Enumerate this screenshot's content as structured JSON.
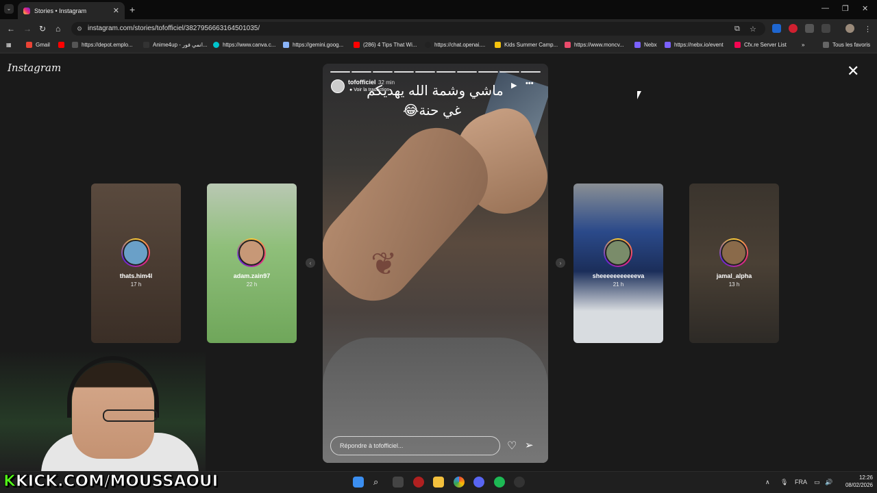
{
  "browser": {
    "tab_title": "Stories • Instagram",
    "new_tab_symbol": "+",
    "close_tab_symbol": "✕",
    "url": "instagram.com/stories/tofofficiel/3827956663164501035/",
    "bookmarks": [
      {
        "label": "Gmail",
        "color": "#ea4335"
      },
      {
        "label": "",
        "color": "#ff0000"
      },
      {
        "label": "https://depot.emplo...",
        "color": "#555555"
      },
      {
        "label": "Anime4up - انمي فور...",
        "color": "#333333"
      },
      {
        "label": "https://www.canva.c...",
        "color": "#00c4cc"
      },
      {
        "label": "https://gemini.goog...",
        "color": "#8ab4f8"
      },
      {
        "label": "(286) 4 Tips That Wi...",
        "color": "#ff0000"
      },
      {
        "label": "https://chat.openai....",
        "color": "#222222"
      },
      {
        "label": "Kids Summer Camp...",
        "color": "#f4c20d"
      },
      {
        "label": "https://www.moncv...",
        "color": "#e94b6b"
      },
      {
        "label": "Nebx",
        "color": "#7b61ff"
      },
      {
        "label": "https://nebx.io/event",
        "color": "#7b61ff"
      },
      {
        "label": "Cfx.re Server List",
        "color": "#f40552"
      }
    ],
    "more_bookmarks": "»",
    "all_bookmarks": "Tous les favoris"
  },
  "instagram": {
    "logo": "Instagram",
    "close": "✕",
    "story": {
      "username": "tofofficiel",
      "time": "32 min",
      "translation": "Voir la traduction",
      "caption_line1": "ماشي وشمة الله يهديكم",
      "caption_line2": "😂غي حنة",
      "reply_placeholder": "Répondre à tofofficiel...",
      "segments": 10
    },
    "side_stories": [
      {
        "username": "thats.him4l",
        "age": "17 h",
        "bg": "#4a3c32"
      },
      {
        "username": "adam.zain97",
        "age": "22 h",
        "bg": "#8fbf7a"
      },
      {
        "username": "sheeeeeeeeeeeva",
        "age": "21 h",
        "bg": "#6c7a8a"
      },
      {
        "username": "jamal_alpha",
        "age": "13 h",
        "bg": "#2d2a26"
      }
    ]
  },
  "overlay": {
    "kick_k": "K",
    "kick_text": "KICK.COM/MOUSSAOUI"
  },
  "taskbar": {
    "language": "FRA",
    "time": "12:26",
    "date": "08/02/2026"
  }
}
